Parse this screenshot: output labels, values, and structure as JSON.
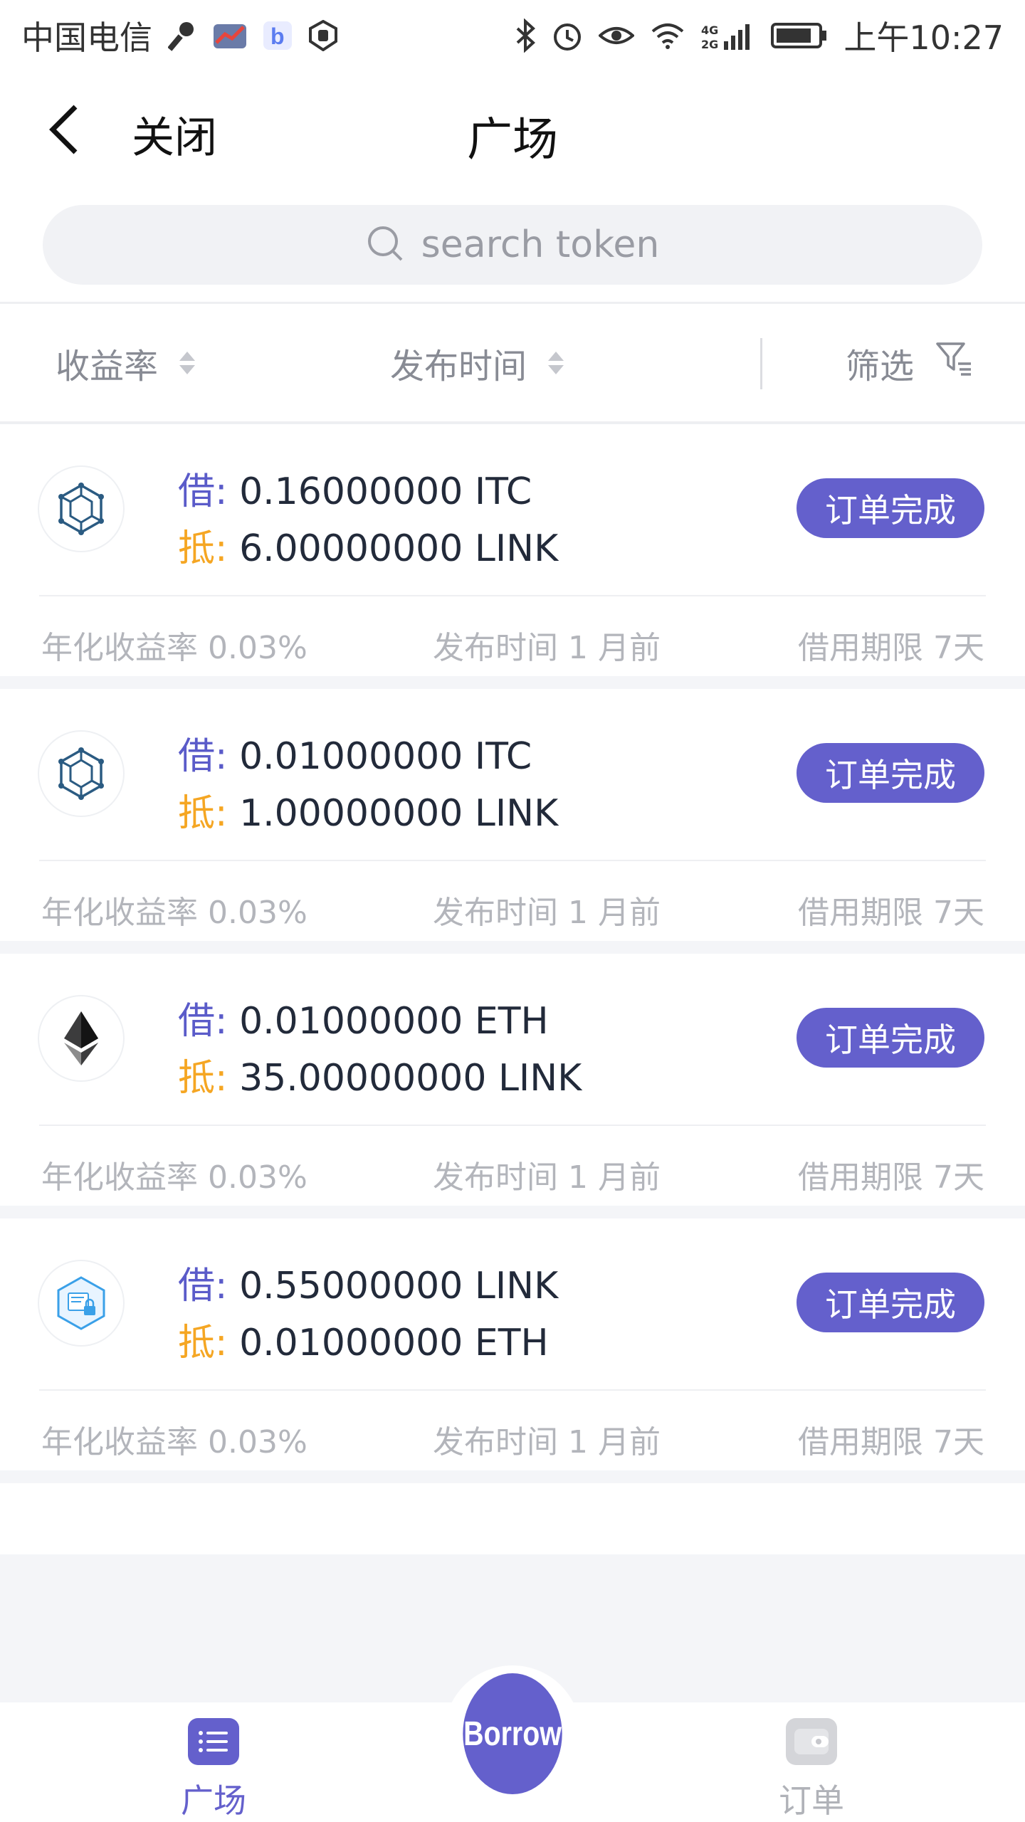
{
  "status_bar": {
    "carrier": "中国电信",
    "time": "上午10:27",
    "network": "4G 2G"
  },
  "nav": {
    "close_label": "关闭",
    "title": "广场"
  },
  "search": {
    "placeholder": "search token"
  },
  "sort_bar": {
    "yield_label": "收益率",
    "time_label": "发布时间",
    "filter_label": "筛选"
  },
  "colors": {
    "accent": "#6460cc",
    "borrow_tag": "#5a5bc9",
    "collateral_tag": "#f5a623"
  },
  "orders": [
    {
      "logo": "itc-hexagon-logo",
      "borrow_tag": "借:",
      "borrow": "0.16000000 ITC",
      "collateral_tag": "抵:",
      "collateral": "6.00000000 LINK",
      "status": "订单完成",
      "yield": "年化收益率 0.03%",
      "published": "发布时间 1 月前",
      "term": "借用期限 7天"
    },
    {
      "logo": "itc-hexagon-logo",
      "borrow_tag": "借:",
      "borrow": "0.01000000 ITC",
      "collateral_tag": "抵:",
      "collateral": "1.00000000 LINK",
      "status": "订单完成",
      "yield": "年化收益率 0.03%",
      "published": "发布时间 1 月前",
      "term": "借用期限 7天"
    },
    {
      "logo": "eth-logo",
      "borrow_tag": "借:",
      "borrow": "0.01000000 ETH",
      "collateral_tag": "抵:",
      "collateral": "35.00000000 LINK",
      "status": "订单完成",
      "yield": "年化收益率 0.03%",
      "published": "发布时间 1 月前",
      "term": "借用期限 7天"
    },
    {
      "logo": "chainlink-logo",
      "borrow_tag": "借:",
      "borrow": "0.55000000 LINK",
      "collateral_tag": "抵:",
      "collateral": "0.01000000 ETH",
      "status": "订单完成",
      "yield": "年化收益率 0.03%",
      "published": "发布时间 1 月前",
      "term": "借用期限 7天"
    }
  ],
  "tab_bar": {
    "plaza_label": "广场",
    "borrow_label": "Borrow",
    "orders_label": "订单"
  }
}
